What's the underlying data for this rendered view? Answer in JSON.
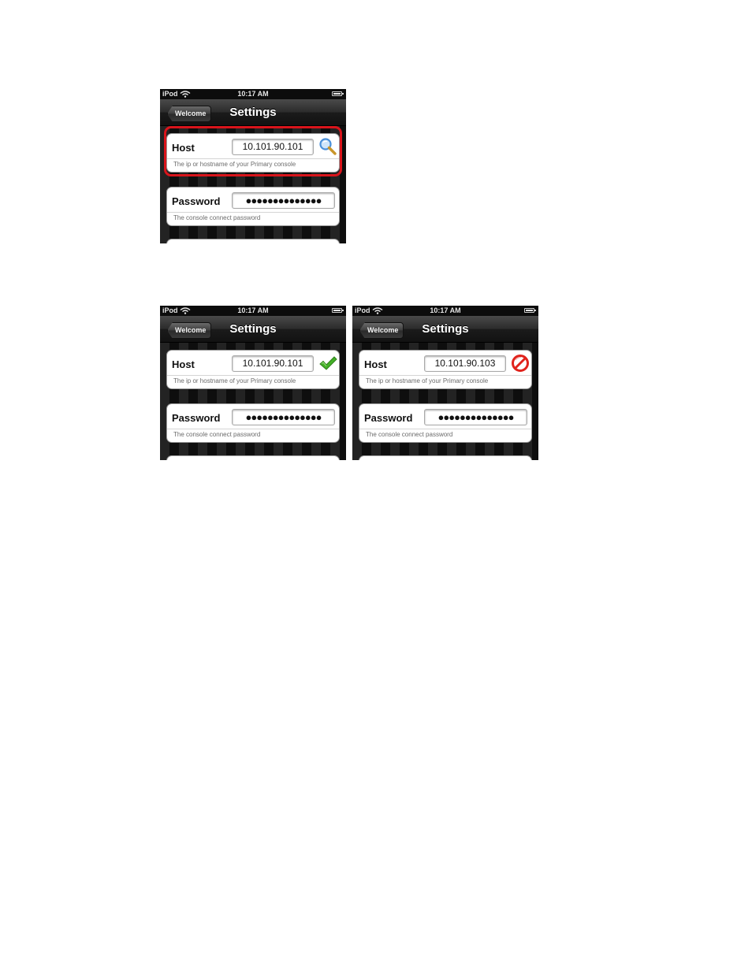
{
  "colors": {
    "highlight": "#d9141b",
    "valid": "#44b028",
    "invalid": "#e0231c",
    "search": "#4a90d9"
  },
  "screens": [
    {
      "status": {
        "device": "iPod",
        "time": "10:17 AM"
      },
      "nav": {
        "back_label": "Welcome",
        "title": "Settings"
      },
      "host": {
        "label": "Host",
        "value": "10.101.90.101",
        "hint": "The ip or hostname of your Primary console",
        "status_icon": "search-magnifier-icon"
      },
      "password": {
        "label": "Password",
        "value": "●●●●●●●●●●●●●●",
        "hint": "The console connect password"
      },
      "highlighted": true
    },
    {
      "status": {
        "device": "iPod",
        "time": "10:17 AM"
      },
      "nav": {
        "back_label": "Welcome",
        "title": "Settings"
      },
      "host": {
        "label": "Host",
        "value": "10.101.90.101",
        "hint": "The ip or hostname of your Primary console",
        "status_icon": "green-checkmark-icon"
      },
      "password": {
        "label": "Password",
        "value": "●●●●●●●●●●●●●●",
        "hint": "The console connect password"
      },
      "highlighted": false
    },
    {
      "status": {
        "device": "iPod",
        "time": "10:17 AM"
      },
      "nav": {
        "back_label": "Welcome",
        "title": "Settings"
      },
      "host": {
        "label": "Host",
        "value": "10.101.90.103",
        "hint": "The ip or hostname of your Primary console",
        "status_icon": "red-invalid-icon"
      },
      "password": {
        "label": "Password",
        "value": "●●●●●●●●●●●●●●",
        "hint": "The console connect password"
      },
      "highlighted": false
    }
  ]
}
